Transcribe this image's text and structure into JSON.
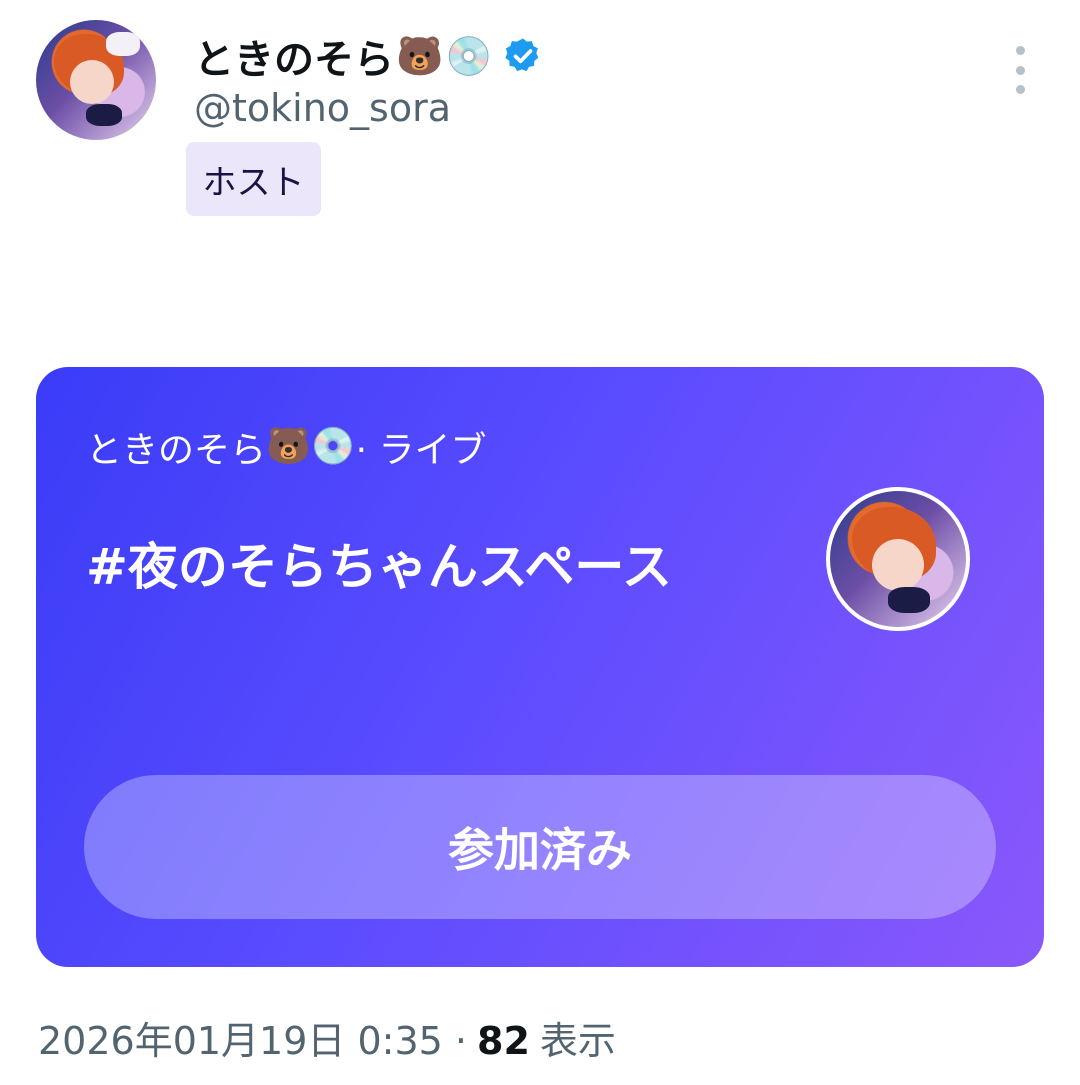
{
  "author": {
    "display_name": "ときのそら",
    "emoji_1": "🐻",
    "emoji_2": "💿",
    "handle": "@tokino_sora",
    "verified_color": "#1d9bf0"
  },
  "role_badge": "ホスト",
  "space_card": {
    "host_line_name": "ときのそら",
    "host_line_emoji_1": "🐻",
    "host_line_emoji_2": "💿",
    "host_line_status": "· ライブ",
    "title": "#夜のそらちゃんスペース",
    "button_label": "参加済み",
    "gradient_start": "#3a3cf7",
    "gradient_end": "#8a58fb"
  },
  "footer": {
    "timestamp": "2026年01月19日 0:35 ·",
    "view_count": "82",
    "views_label": "表示"
  }
}
